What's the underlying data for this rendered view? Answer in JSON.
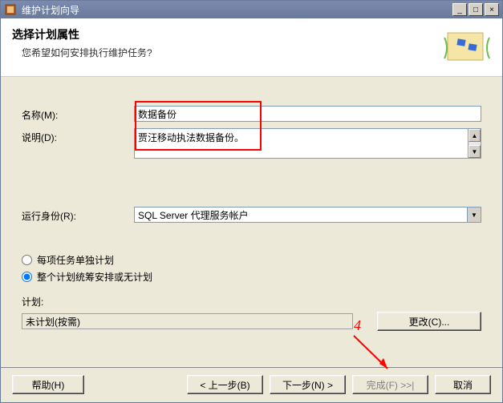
{
  "window": {
    "title": "维护计划向导"
  },
  "header": {
    "heading": "选择计划属性",
    "subtext": "您希望如何安排执行维护任务?"
  },
  "form": {
    "name_label": "名称(M):",
    "name_value": "数据备份",
    "desc_label": "说明(D):",
    "desc_value": "贾汪移动执法数据备份。",
    "runas_label": "运行身份(R):",
    "runas_value": "SQL Server 代理服务帐户"
  },
  "schedule_mode": {
    "opt1_label": "每项任务单独计划",
    "opt2_label": "整个计划统筹安排或无计划",
    "selected": "opt2"
  },
  "plan": {
    "section_label": "计划:",
    "value": "未计划(按需)",
    "change_button": "更改(C)..."
  },
  "annotation": {
    "number": "4"
  },
  "footer": {
    "help": "帮助(H)",
    "back": "< 上一步(B)",
    "next": "下一步(N) >",
    "finish": "完成(F) >>|",
    "cancel": "取消"
  }
}
